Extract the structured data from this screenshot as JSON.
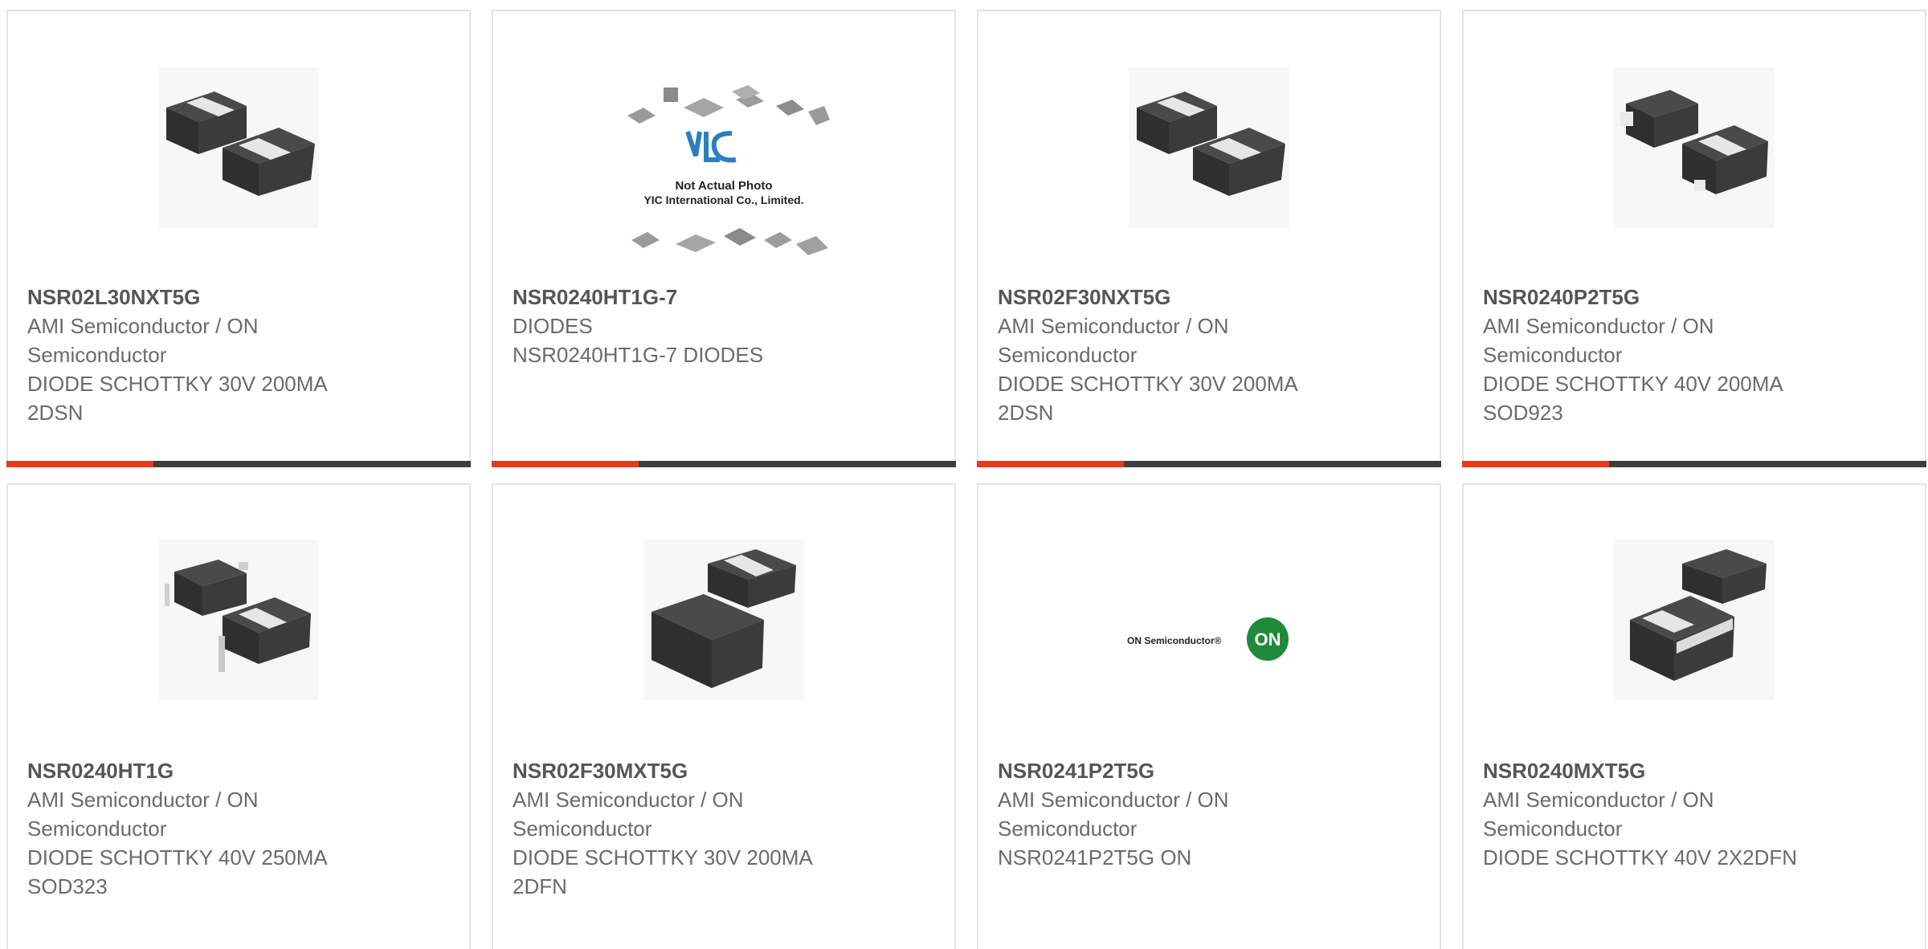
{
  "colors": {
    "accent": "#e8391a",
    "bar": "#3d3d3d",
    "border": "#e3e3e3",
    "text": "#6a6a6a",
    "title": "#555555"
  },
  "products": [
    {
      "part": "NSR02L30NXT5G",
      "mfr": "AMI Semiconductor / ON Semiconductor",
      "desc": "DIODE SCHOTTKY 30V 200MA 2DSN",
      "icon": "diode-package-photo"
    },
    {
      "part": "NSR0240HT1G-7",
      "mfr": "DIODES",
      "desc": "NSR0240HT1G-7 DIODES",
      "icon": "not-actual-photo-placeholder",
      "placeholder_logo": "YIC",
      "placeholder_line1": "Not Actual Photo",
      "placeholder_line2": "YIC International Co., Limited."
    },
    {
      "part": "NSR02F30NXT5G",
      "mfr": "AMI Semiconductor / ON Semiconductor",
      "desc": "DIODE SCHOTTKY 30V 200MA 2DSN",
      "icon": "diode-package-photo"
    },
    {
      "part": "NSR0240P2T5G",
      "mfr": "AMI Semiconductor / ON Semiconductor",
      "desc": "DIODE SCHOTTKY 40V 200MA SOD923",
      "icon": "diode-package-photo"
    },
    {
      "part": "NSR0240HT1G",
      "mfr": "AMI Semiconductor / ON Semiconductor",
      "desc": "DIODE SCHOTTKY 40V 250MA SOD323",
      "icon": "diode-package-photo"
    },
    {
      "part": "NSR02F30MXT5G",
      "mfr": "AMI Semiconductor / ON Semiconductor",
      "desc": "DIODE SCHOTTKY 30V 200MA 2DFN",
      "icon": "diode-package-photo"
    },
    {
      "part": "NSR0241P2T5G",
      "mfr": "AMI Semiconductor / ON Semiconductor",
      "desc": "NSR0241P2T5G ON",
      "icon": "on-semiconductor-logo",
      "logo_text": "ON Semiconductor®",
      "logo_badge": "ON"
    },
    {
      "part": "NSR0240MXT5G",
      "mfr": "AMI Semiconductor / ON Semiconductor",
      "desc": "DIODE SCHOTTKY 40V 2X2DFN",
      "icon": "diode-package-photo"
    }
  ]
}
